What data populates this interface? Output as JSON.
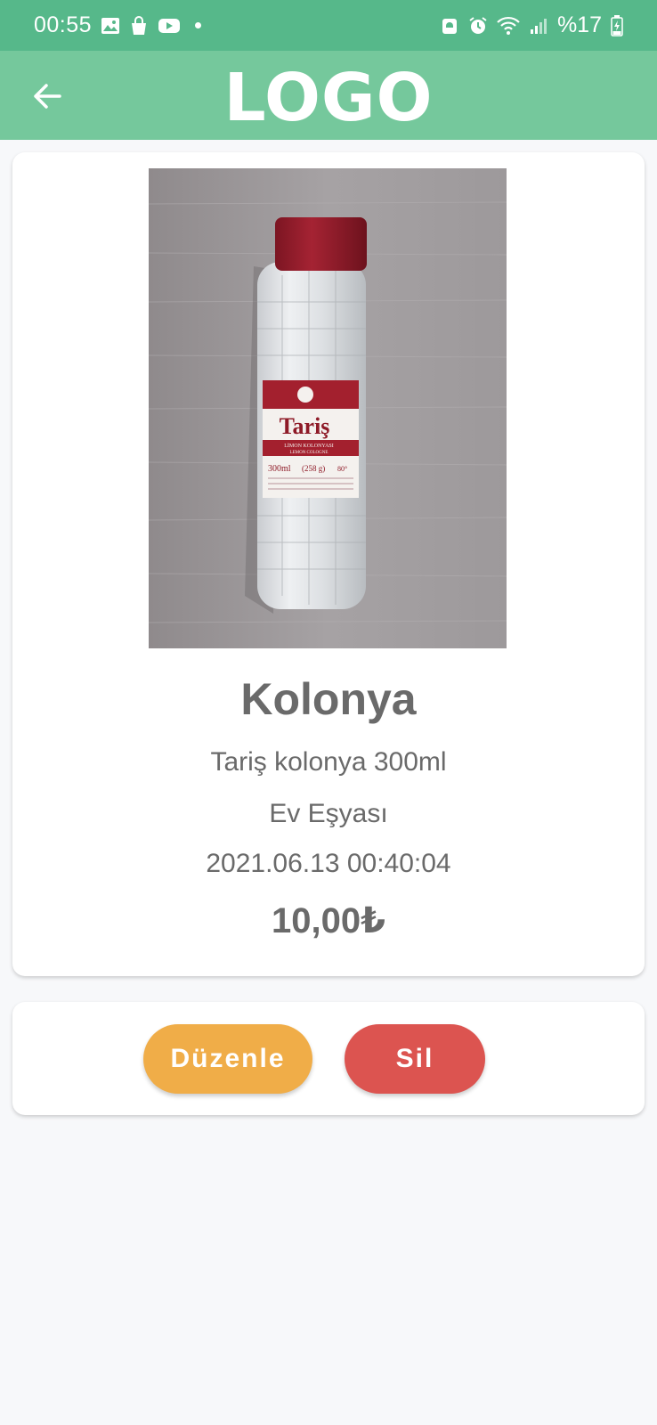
{
  "status_bar": {
    "time": "00:55",
    "battery": "%17",
    "icons": [
      "image-icon",
      "shopping-bag-icon",
      "youtube-icon",
      "notification-dot-icon",
      "android-icon",
      "alarm-icon",
      "wifi-icon",
      "signal-icon",
      "battery-charging-icon"
    ]
  },
  "header": {
    "logo": "LOGO",
    "back_icon": "arrow-left-icon",
    "background": "#75c89c"
  },
  "product": {
    "title": "Kolonya",
    "description": "Tariş kolonya 300ml",
    "category": "Ev Eşyası",
    "date": "2021.06.13 00:40:04",
    "price": "10,00₺",
    "image": {
      "label_brand": "Tariş",
      "label_line1": "LİMON KOLONYASI",
      "label_line2": "LEMON COLOGNE",
      "label_volume": "300ml",
      "label_weight": "(258 g)",
      "label_degree": "80°"
    }
  },
  "actions": {
    "edit_label": "Düzenle",
    "delete_label": "Sil",
    "edit_color": "#f0ad48",
    "delete_color": "#dc5450"
  }
}
